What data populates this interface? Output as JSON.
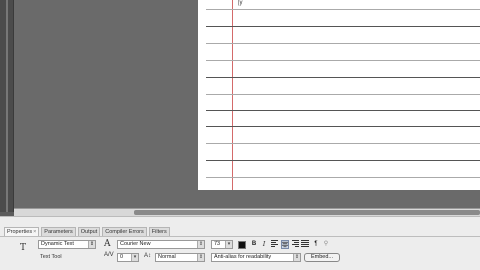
{
  "stage": {
    "cursor_text": "|y"
  },
  "panel": {
    "tabs": [
      {
        "label": "Properties",
        "active": true
      },
      {
        "label": "Parameters",
        "active": false
      },
      {
        "label": "Output",
        "active": false
      },
      {
        "label": "Compiler Errors",
        "active": false
      },
      {
        "label": "Filters",
        "active": false
      }
    ],
    "text_type": "Dynamic Text",
    "instance_label": "Text Tool",
    "font_family": "Courier New",
    "font_size": "73",
    "letter_spacing": "0",
    "position_mode": "Normal",
    "anti_alias": "Anti-alias for readability",
    "embed_label": "Embed...",
    "bold_label": "B",
    "italic_label": "I",
    "tab_close": "×",
    "dropdown_arrow": "▾",
    "stepper_arrow": "⇕",
    "text_icon_char": "T",
    "font_icon_char": "A",
    "spacing_icon_char": "A/V",
    "position_icon_char": "A↕",
    "paragraph_char": "¶",
    "link_char": "⚲"
  },
  "colors": {
    "text_color": "#111111",
    "margin_rule": "#d46a6a"
  }
}
